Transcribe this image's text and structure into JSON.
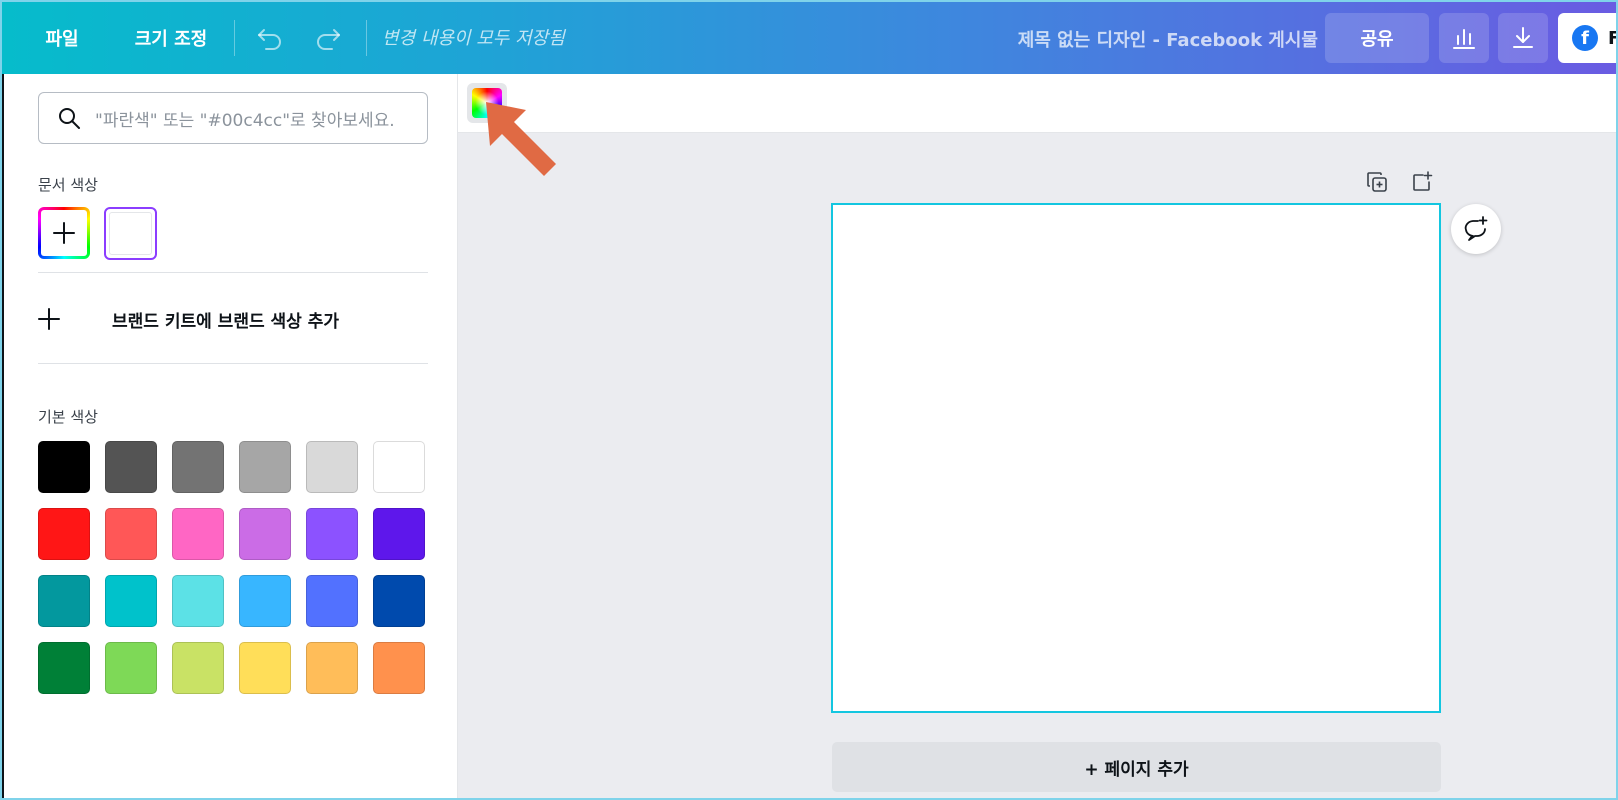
{
  "topbar": {
    "file_label": "파일",
    "resize_label": "크기 조정",
    "undo_icon": "undo-icon",
    "redo_icon": "redo-icon",
    "saved_status": "변경 내용이 모두 저장됨",
    "doc_title": "제목 없는 디자인 - Facebook 게시물",
    "share_label": "공유",
    "insights_icon": "bar-chart-icon",
    "download_icon": "download-icon",
    "facebook_label": "F",
    "facebook_logo": "f"
  },
  "panel": {
    "search_placeholder": "\"파란색\" 또는 \"#00c4cc\"로 찾아보세요.",
    "doc_colors_label": "문서 색상",
    "brand_kit_label": "브랜드 키트에 브랜드 색상 추가",
    "default_colors_label": "기본 색상",
    "default_colors": [
      "#000000",
      "#545454",
      "#737373",
      "#a6a6a6",
      "#d9d9d9",
      "#ffffff",
      "#ff1616",
      "#ff5757",
      "#ff66c4",
      "#cb6ce6",
      "#8c52ff",
      "#5e17eb",
      "#03989e",
      "#00c2cb",
      "#5ce1e6",
      "#38b6ff",
      "#5271ff",
      "#004aad",
      "#008037",
      "#7ed957",
      "#c9e265",
      "#ffde59",
      "#ffbd59",
      "#ff914d"
    ],
    "doc_colors": [
      "#ffffff"
    ]
  },
  "canvas": {
    "add_page_label": "+ 페이지 추가",
    "accent": "#13c6e0",
    "arrow_color": "#e06a44"
  }
}
